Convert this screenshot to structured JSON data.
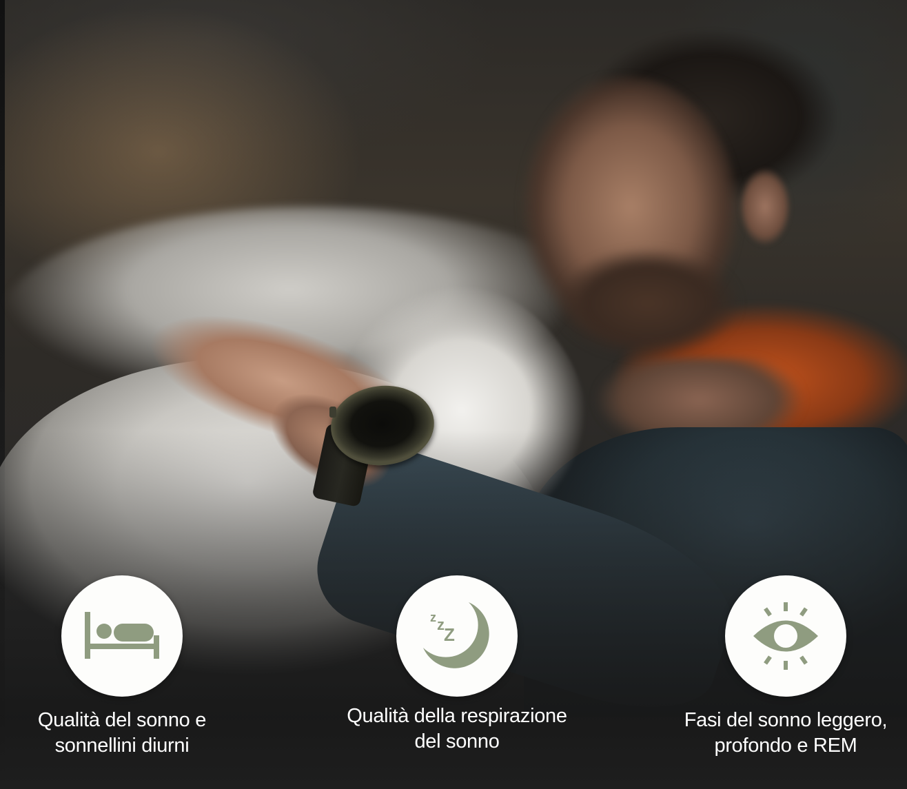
{
  "features": [
    {
      "icon": "bed-icon",
      "label": "Qualità del sonno e\nsonnellini diurni"
    },
    {
      "icon": "moon-zzz-icon",
      "label": "Qualità della respirazione\ndel sonno"
    },
    {
      "icon": "eye-icon",
      "label": "Fasi del sonno leggero,\nprofondo e REM"
    }
  ],
  "colors": {
    "icon_green": "#8f9c80",
    "circle_bg": "#fdfdfb",
    "text": "#ffffff"
  }
}
